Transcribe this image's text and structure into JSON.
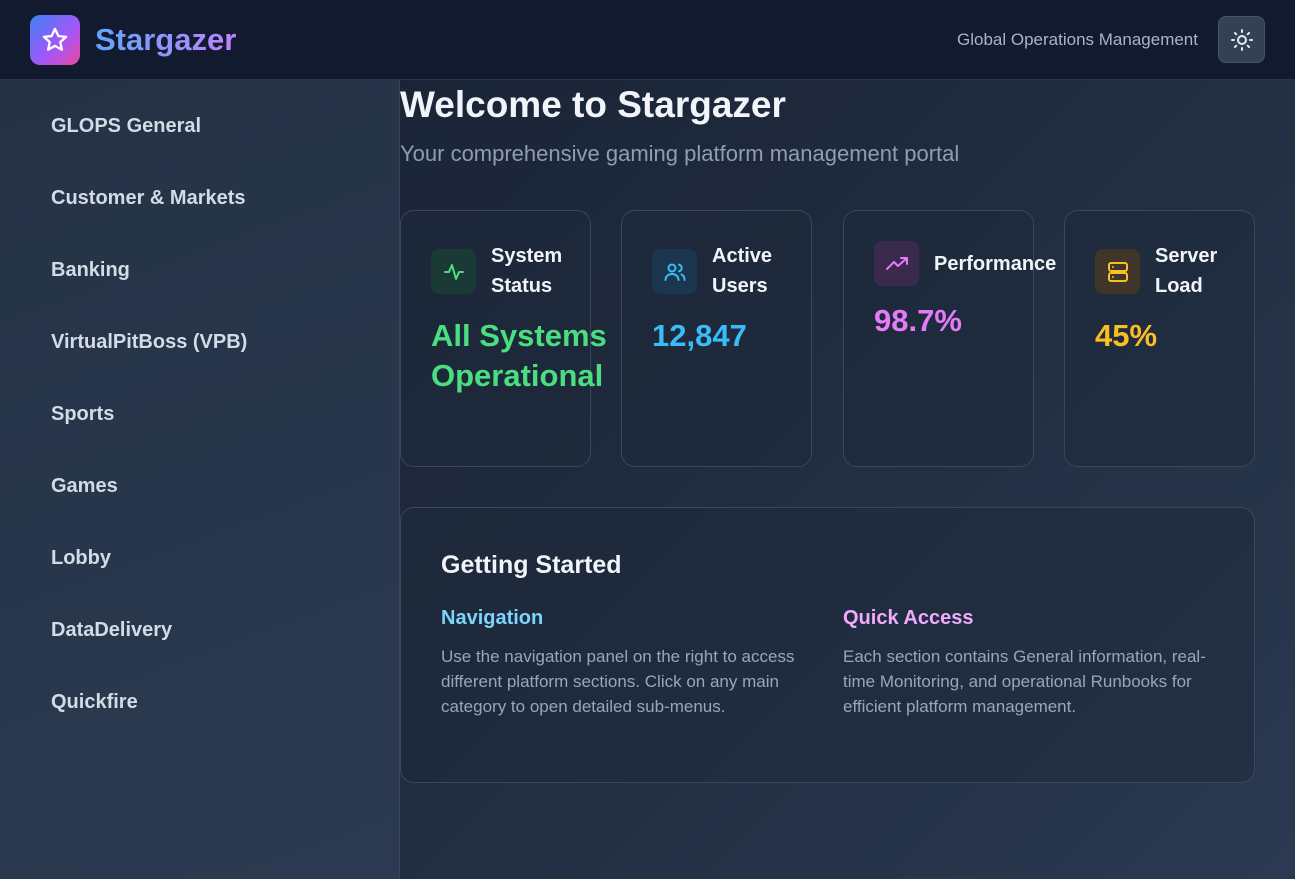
{
  "header": {
    "app_name": "Stargazer",
    "org_name": "Global Operations Management",
    "logo_icon": "star-icon",
    "theme_toggle_icon": "sun-icon"
  },
  "sidebar": {
    "items": [
      {
        "label": "GLOPS General"
      },
      {
        "label": "Customer & Markets"
      },
      {
        "label": "Banking"
      },
      {
        "label": "VirtualPitBoss (VPB)"
      },
      {
        "label": "Sports"
      },
      {
        "label": "Games"
      },
      {
        "label": "Lobby"
      },
      {
        "label": "DataDelivery"
      },
      {
        "label": "Quickfire"
      }
    ]
  },
  "main": {
    "title": "Welcome to Stargazer",
    "subtitle": "Your comprehensive gaming platform management portal",
    "stats": [
      {
        "label": "System Status",
        "value": "All Systems Operational",
        "icon": "activity-icon",
        "color": "#4ade80"
      },
      {
        "label": "Active Users",
        "value": "12,847",
        "icon": "users-icon",
        "color": "#38bdf8"
      },
      {
        "label": "Performance",
        "value": "98.7%",
        "icon": "trending-up-icon",
        "color": "#e879f9"
      },
      {
        "label": "Server Load",
        "value": "45%",
        "icon": "server-icon",
        "color": "#fbbf24"
      }
    ],
    "getting_started": {
      "title": "Getting Started",
      "navigation": {
        "heading": "Navigation",
        "text": "Use the navigation panel on the right to access different platform sections. Click on any main category to open detailed sub-menus.",
        "color": "#7dd3fc"
      },
      "quick_access": {
        "heading": "Quick Access",
        "text": "Each section contains General information, real-time Monitoring, and operational Runbooks for efficient platform management.",
        "color": "#f0abfc"
      }
    }
  }
}
